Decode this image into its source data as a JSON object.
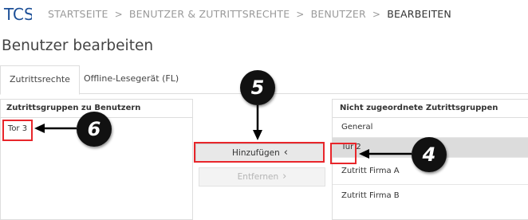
{
  "app": {
    "logo_text": "TCS"
  },
  "breadcrumb": {
    "items": [
      "STARTSEITE",
      "BENUTZER & ZUTRITTSRECHTE",
      "BENUTZER",
      "BEARBEITEN"
    ],
    "separator": ">"
  },
  "page": {
    "title": "Benutzer bearbeiten"
  },
  "tabs": [
    {
      "label": "Zutrittsrechte",
      "active": true
    },
    {
      "label": "Offline-Lesegerät (FL)",
      "active": false
    }
  ],
  "left_panel": {
    "header": "Zutrittsgruppen zu Benutzern",
    "items": [
      "Tor 3"
    ]
  },
  "right_panel": {
    "header": "Nicht zugeordnete Zutrittsgruppen",
    "items": [
      "General",
      "Tür 2",
      "Zutritt Firma A",
      "Zutritt Firma B"
    ],
    "selected_index": 1
  },
  "actions": {
    "add_label": "Hinzufügen",
    "add_icon": "chevron-left-icon",
    "remove_label": "Entfernen",
    "remove_icon": "chevron-right-icon"
  },
  "callouts": {
    "left_item": "6",
    "add_button": "5",
    "right_item": "4"
  },
  "colors": {
    "highlight": "#e8262b",
    "selected_row": "#dcdcdc",
    "callout_bg": "#111111"
  }
}
